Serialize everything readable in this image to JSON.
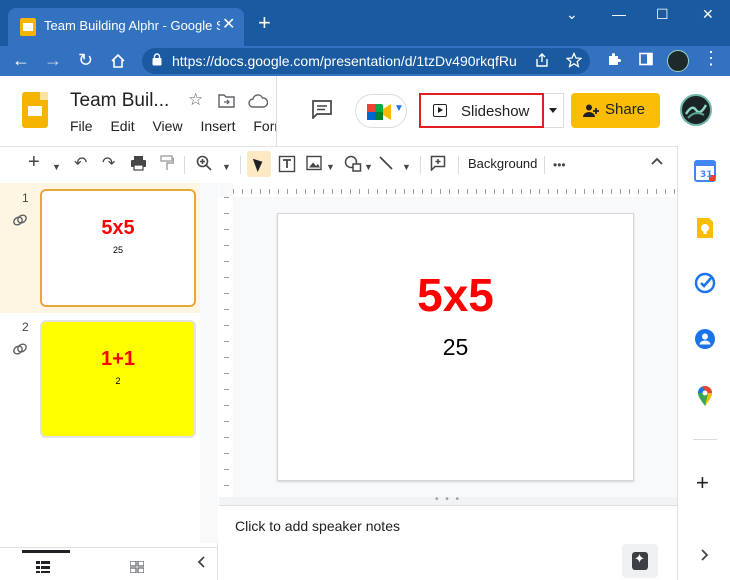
{
  "browser": {
    "tab_title": "Team Building Alphr - Google Slides",
    "tab_close": "✕",
    "new_tab": "+",
    "url": "https://docs.google.com/presentation/d/1tzDv490rkqfRu",
    "window_controls": {
      "chevron": "⌄",
      "minimize": "—",
      "maximize": "☐",
      "close": "✕"
    },
    "nav": {
      "back": "←",
      "forward": "→",
      "reload": "↻"
    }
  },
  "app": {
    "doc_title": "Team Buil...",
    "menu": [
      "File",
      "Edit",
      "View",
      "Insert",
      "Format"
    ],
    "slideshow_label": "Slideshow",
    "share_label": "Share"
  },
  "toolbar": {
    "background_label": "Background",
    "more": "•••"
  },
  "filmstrip": {
    "slides": [
      {
        "number": "1",
        "title": "5x5",
        "subtitle": "25",
        "background": "#ffffff"
      },
      {
        "number": "2",
        "title": "1+1",
        "subtitle": "2",
        "background": "#ffff00"
      }
    ]
  },
  "slide": {
    "title": "5x5",
    "subtitle": "25",
    "title_color": "#ff0000"
  },
  "notes": {
    "placeholder": "Click to add speaker notes"
  },
  "colors": {
    "chrome_dark": "#1a5aa0",
    "chrome_light": "#3372c0",
    "share_button": "#fbbc04",
    "highlight_border": "#e02020",
    "active_slide_border": "#e8a93a"
  },
  "icons": {
    "side_panel": [
      "calendar-icon",
      "keep-icon",
      "tasks-icon",
      "contacts-icon",
      "maps-icon"
    ]
  }
}
